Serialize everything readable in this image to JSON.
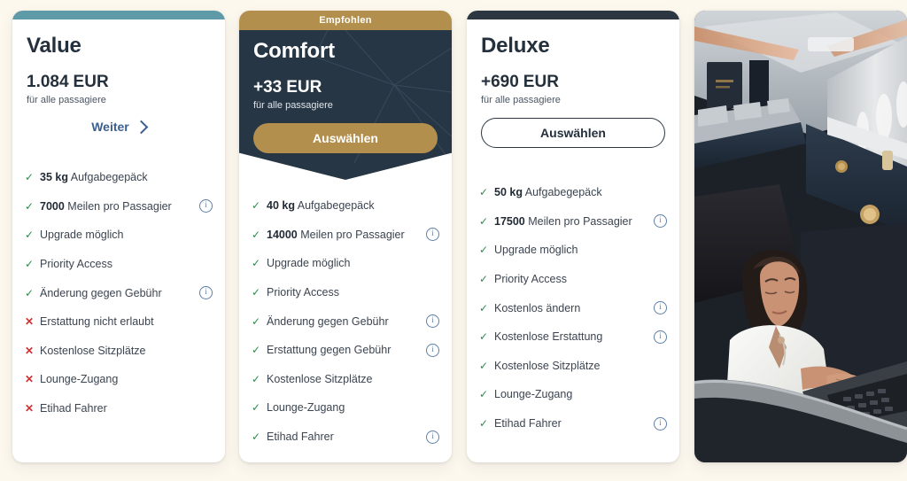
{
  "background_color": "#fdf8ee",
  "colors": {
    "value_accent": "#5f9aa8",
    "comfort_ribbon": "#b38f4d",
    "comfort_header": "#263644",
    "deluxe_accent": "#2c3742",
    "check": "#2e8b4f",
    "cross": "#cf3030",
    "link": "#3b5f90",
    "info": "#5d7fa8"
  },
  "cards": [
    {
      "id": "value",
      "name": "Value",
      "price_amount": "1.084",
      "price_currency": "EUR",
      "price_sub": "für alle passagiere",
      "cta_label": "Weiter",
      "cta_type": "link",
      "features": [
        {
          "state": "ok",
          "bold": "35 kg",
          "text": "Aufgabegepäck",
          "info": false
        },
        {
          "state": "ok",
          "bold": "7000",
          "text": "Meilen pro Passagier",
          "info": true
        },
        {
          "state": "ok",
          "bold": "",
          "text": "Upgrade möglich",
          "info": false
        },
        {
          "state": "ok",
          "bold": "",
          "text": "Priority Access",
          "info": false
        },
        {
          "state": "ok",
          "bold": "",
          "text": "Änderung gegen Gebühr",
          "info": true
        },
        {
          "state": "no",
          "bold": "",
          "text": "Erstattung nicht erlaubt",
          "info": false
        },
        {
          "state": "no",
          "bold": "",
          "text": "Kostenlose Sitzplätze",
          "info": false
        },
        {
          "state": "no",
          "bold": "",
          "text": "Lounge-Zugang",
          "info": false
        },
        {
          "state": "no",
          "bold": "",
          "text": "Etihad Fahrer",
          "info": false
        }
      ]
    },
    {
      "id": "comfort",
      "name": "Comfort",
      "ribbon": "Empfohlen",
      "price_amount": "+33",
      "price_currency": "EUR",
      "price_sub": "für alle passagiere",
      "cta_label": "Auswählen",
      "cta_type": "gold-button",
      "features": [
        {
          "state": "ok",
          "bold": "40 kg",
          "text": "Aufgabegepäck",
          "info": false
        },
        {
          "state": "ok",
          "bold": "14000",
          "text": "Meilen pro Passagier",
          "info": true
        },
        {
          "state": "ok",
          "bold": "",
          "text": "Upgrade möglich",
          "info": false
        },
        {
          "state": "ok",
          "bold": "",
          "text": "Priority Access",
          "info": false
        },
        {
          "state": "ok",
          "bold": "",
          "text": "Änderung gegen Gebühr",
          "info": true
        },
        {
          "state": "ok",
          "bold": "",
          "text": "Erstattung gegen Gebühr",
          "info": true
        },
        {
          "state": "ok",
          "bold": "",
          "text": "Kostenlose Sitzplätze",
          "info": false
        },
        {
          "state": "ok",
          "bold": "",
          "text": "Lounge-Zugang",
          "info": false
        },
        {
          "state": "ok",
          "bold": "",
          "text": "Etihad Fahrer",
          "info": true
        }
      ]
    },
    {
      "id": "deluxe",
      "name": "Deluxe",
      "price_amount": "+690",
      "price_currency": "EUR",
      "price_sub": "für alle passagiere",
      "cta_label": "Auswählen",
      "cta_type": "outline-button",
      "features": [
        {
          "state": "ok",
          "bold": "50 kg",
          "text": "Aufgabegepäck",
          "info": false
        },
        {
          "state": "ok",
          "bold": "17500",
          "text": "Meilen pro Passagier",
          "info": true
        },
        {
          "state": "ok",
          "bold": "",
          "text": "Upgrade möglich",
          "info": false
        },
        {
          "state": "ok",
          "bold": "",
          "text": "Priority Access",
          "info": false
        },
        {
          "state": "ok",
          "bold": "",
          "text": "Kostenlos ändern",
          "info": true
        },
        {
          "state": "ok",
          "bold": "",
          "text": "Kostenlose Erstattung",
          "info": true
        },
        {
          "state": "ok",
          "bold": "",
          "text": "Kostenlose Sitzplätze",
          "info": false
        },
        {
          "state": "ok",
          "bold": "",
          "text": "Lounge-Zugang",
          "info": false
        },
        {
          "state": "ok",
          "bold": "",
          "text": "Etihad Fahrer",
          "info": true
        }
      ]
    }
  ],
  "photo": {
    "alt": "business-class-cabin-woman-with-laptop"
  },
  "icons": {
    "check": "✓",
    "cross": "✕",
    "info": "i",
    "chevron": "chevron-right-icon"
  }
}
